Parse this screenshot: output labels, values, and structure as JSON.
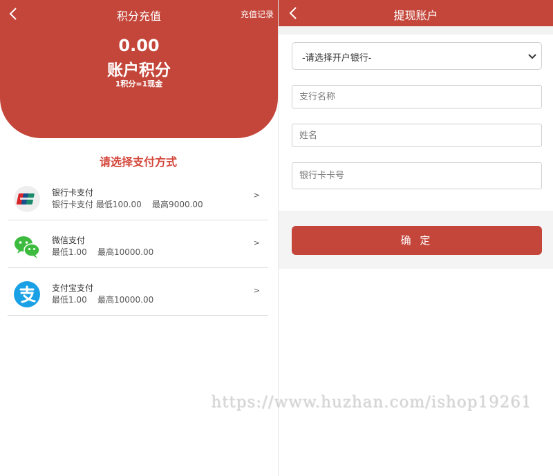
{
  "left": {
    "header": {
      "title": "积分充值",
      "records_label": "充值记录"
    },
    "balance": {
      "amount": "0.00",
      "label": "账户积分",
      "rate": "1积分=1现金"
    },
    "choose_title": "请选择支付方式",
    "methods": [
      {
        "name": "银行卡支付",
        "desc": "银行卡支付 最低100.00    最高9000.00",
        "icon": "unionpay-icon",
        "arrow": ">"
      },
      {
        "name": "微信支付",
        "desc": "最低1.00    最高10000.00",
        "icon": "wechat-pay-icon",
        "arrow": ">"
      },
      {
        "name": "支付宝支付",
        "desc": "最低1.00    最高10000.00",
        "icon": "alipay-icon",
        "arrow": ">"
      }
    ]
  },
  "right": {
    "header": {
      "title": "提现账户"
    },
    "form": {
      "bank_select": "-请选择开户银行-",
      "branch_placeholder": "支行名称",
      "name_placeholder": "姓名",
      "card_placeholder": "银行卡卡号",
      "confirm_label": "确 定"
    }
  },
  "watermark": "https://www.huzhan.com/ishop19261",
  "colors": {
    "brand_red": "#c4463a",
    "accent_text": "#d4463a",
    "wechat_green": "#3dbb3f",
    "alipay_blue": "#1aa1e5"
  }
}
